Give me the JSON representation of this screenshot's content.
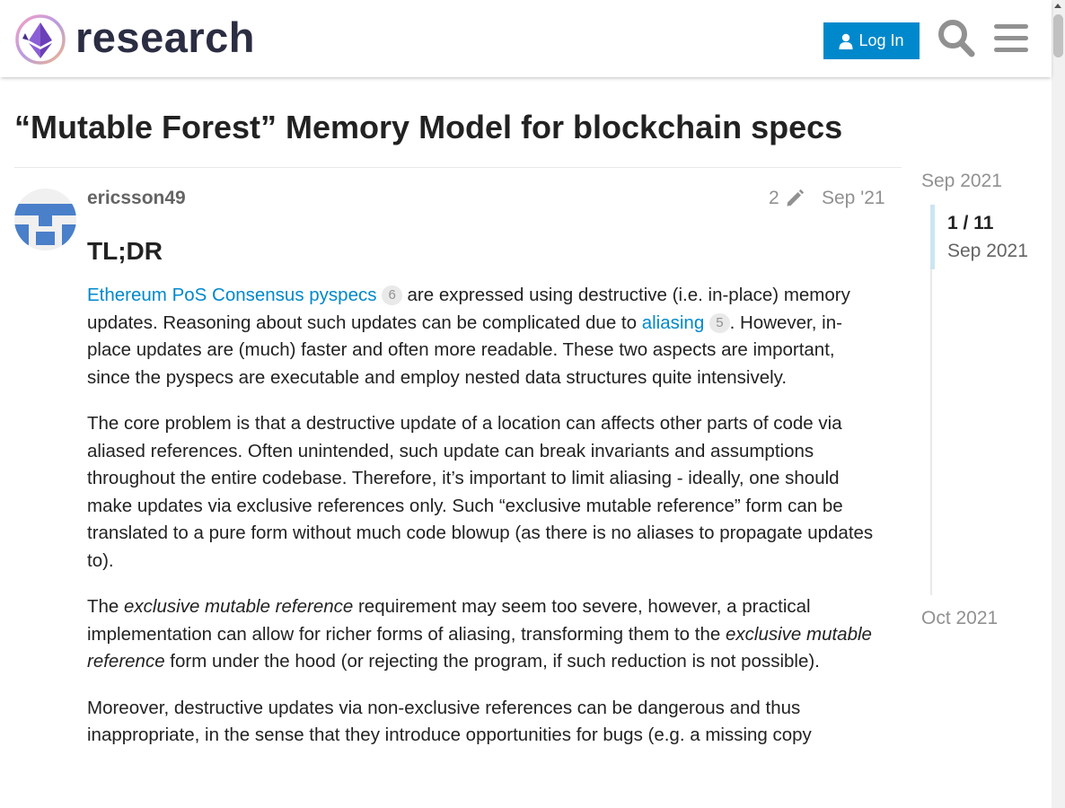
{
  "header": {
    "site_name": "research",
    "login_label": "Log In",
    "search_icon": "search-icon",
    "menu_icon": "hamburger-menu-icon"
  },
  "topic": {
    "title": "“Mutable Forest” Memory Model for blockchain specs"
  },
  "post": {
    "username": "ericsson49",
    "edit_count": "2",
    "date": "Sep '21",
    "heading": "TL;DR",
    "p1": {
      "link1_text": "Ethereum PoS Consensus pyspecs",
      "link1_clicks": "6",
      "text1": " are expressed using destructive (i.e. in-place) memory updates. Reasoning about such updates can be complicated due to ",
      "link2_text": "aliasing",
      "link2_clicks": "5",
      "text2": ". However, in-place updates are (much) faster and often more readable. These two aspects are important, since the pyspecs are executable and employ nested data structures quite intensively."
    },
    "p2": "The core problem is that a destructive update of a location can affects other parts of code via aliased references. Often unintended, such update can break invariants and assumptions throughout the entire codebase. Therefore, it’s important to limit aliasing - ideally, one should make updates via exclusive references only. Such “exclusive mutable reference” form can be translated to a pure form without much code blowup (as there is no aliases to propagate updates to).",
    "p3": {
      "a": "The ",
      "em1": "exclusive mutable reference",
      "b": " requirement may seem too severe, however, a practical implementation can allow for richer forms of aliasing, transforming them to the ",
      "em2": "exclusive mutable reference",
      "c": " form under the hood (or rejecting the program, if such reduction is not possible)."
    },
    "p4": "Moreover, destructive updates via non-exclusive references can be dangerous and thus inappropriate, in the sense that they introduce opportunities for bugs (e.g. a missing copy"
  },
  "timeline": {
    "start_date": "Sep 2021",
    "position": "1 / 11",
    "current_date": "Sep 2021",
    "end_date": "Oct 2021"
  },
  "colors": {
    "link": "#0088cc",
    "button_bg": "#0088cc",
    "muted": "#919191",
    "avatar": "#4a7fc9"
  }
}
